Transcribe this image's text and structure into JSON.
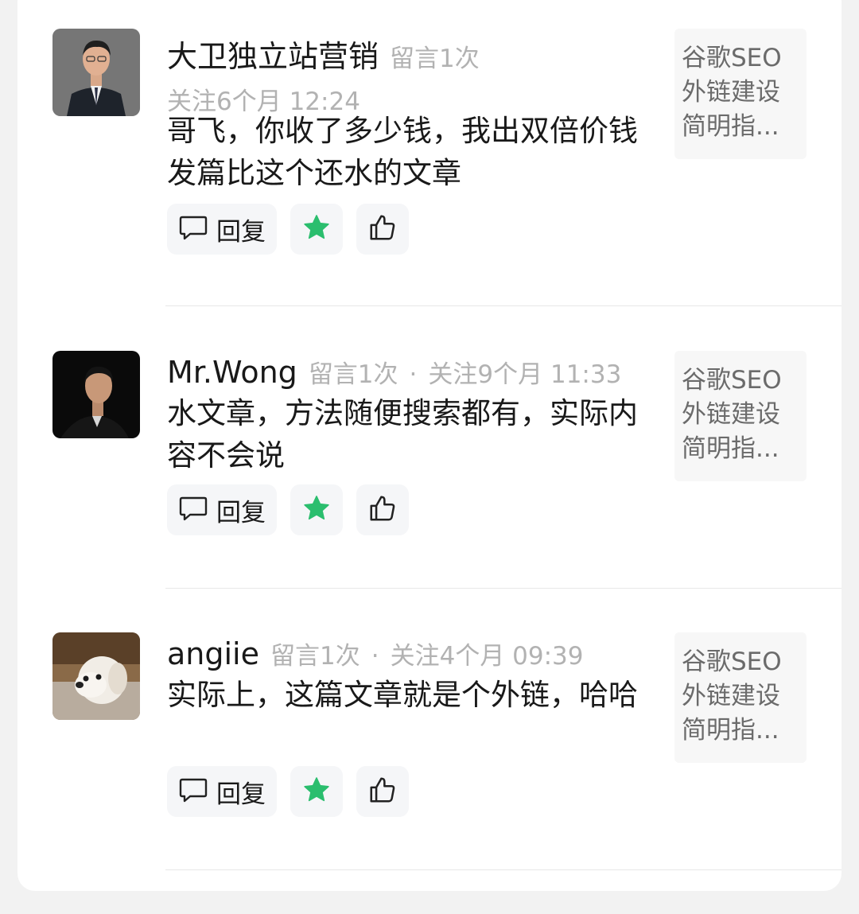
{
  "comments": [
    {
      "username": "大卫独立站营销",
      "meta_count": "留言1次",
      "meta_follow": "关注6个月 12:24",
      "content": "哥飞，你收了多少钱，我出双倍价钱发篇比这个还水的文章",
      "reply_label": "回复",
      "article": [
        "谷歌SEO",
        "外链建设",
        "简明指..."
      ]
    },
    {
      "username": "Mr.Wong",
      "meta_count": "留言1次",
      "meta_follow": "关注9个月 11:33",
      "content": "水文章，方法随便搜索都有，实际内容不会说",
      "reply_label": "回复",
      "article": [
        "谷歌SEO",
        "外链建设",
        "简明指..."
      ]
    },
    {
      "username": "angiie",
      "meta_count": "留言1次",
      "meta_follow": "关注4个月 09:39",
      "content": "实际上，这篇文章就是个外链，哈哈",
      "reply_label": "回复",
      "article": [
        "谷歌SEO",
        "外链建设",
        "简明指..."
      ]
    }
  ],
  "separator": "·",
  "colors": {
    "accent": "#2bbe6e",
    "meta": "#b2b2b2",
    "text": "#191919"
  },
  "icons": {
    "reply": "comment-bubble-icon",
    "favorite": "star-icon",
    "like": "thumbs-up-icon"
  }
}
